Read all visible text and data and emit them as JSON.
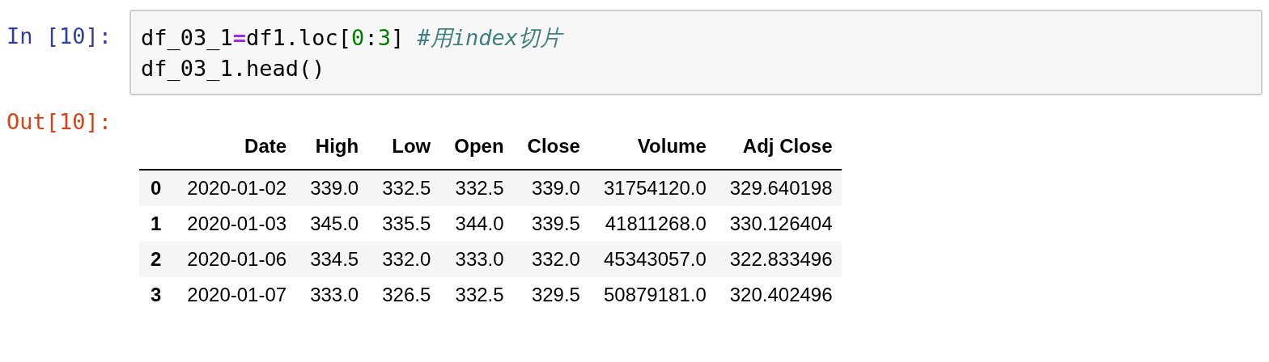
{
  "input_cell": {
    "prompt": "In [10]:",
    "lines": [
      [
        {
          "kind": "name",
          "text": "df_03_1"
        },
        {
          "kind": "op",
          "text": "="
        },
        {
          "kind": "name",
          "text": "df1.loc["
        },
        {
          "kind": "num",
          "text": "0"
        },
        {
          "kind": "name",
          "text": ":"
        },
        {
          "kind": "num",
          "text": "3"
        },
        {
          "kind": "name",
          "text": "] "
        },
        {
          "kind": "comment",
          "text": "#用index切片"
        }
      ],
      [
        {
          "kind": "name",
          "text": "df_03_1.head()"
        }
      ]
    ]
  },
  "output_cell": {
    "prompt": "Out[10]:",
    "table": {
      "columns": [
        "Date",
        "High",
        "Low",
        "Open",
        "Close",
        "Volume",
        "Adj Close"
      ],
      "rows": [
        {
          "index": "0",
          "cells": [
            "2020-01-02",
            "339.0",
            "332.5",
            "332.5",
            "339.0",
            "31754120.0",
            "329.640198"
          ]
        },
        {
          "index": "1",
          "cells": [
            "2020-01-03",
            "345.0",
            "335.5",
            "344.0",
            "339.5",
            "41811268.0",
            "330.126404"
          ]
        },
        {
          "index": "2",
          "cells": [
            "2020-01-06",
            "334.5",
            "332.0",
            "333.0",
            "332.0",
            "45343057.0",
            "322.833496"
          ]
        },
        {
          "index": "3",
          "cells": [
            "2020-01-07",
            "333.0",
            "326.5",
            "332.5",
            "329.5",
            "50879181.0",
            "320.402496"
          ]
        }
      ]
    }
  }
}
